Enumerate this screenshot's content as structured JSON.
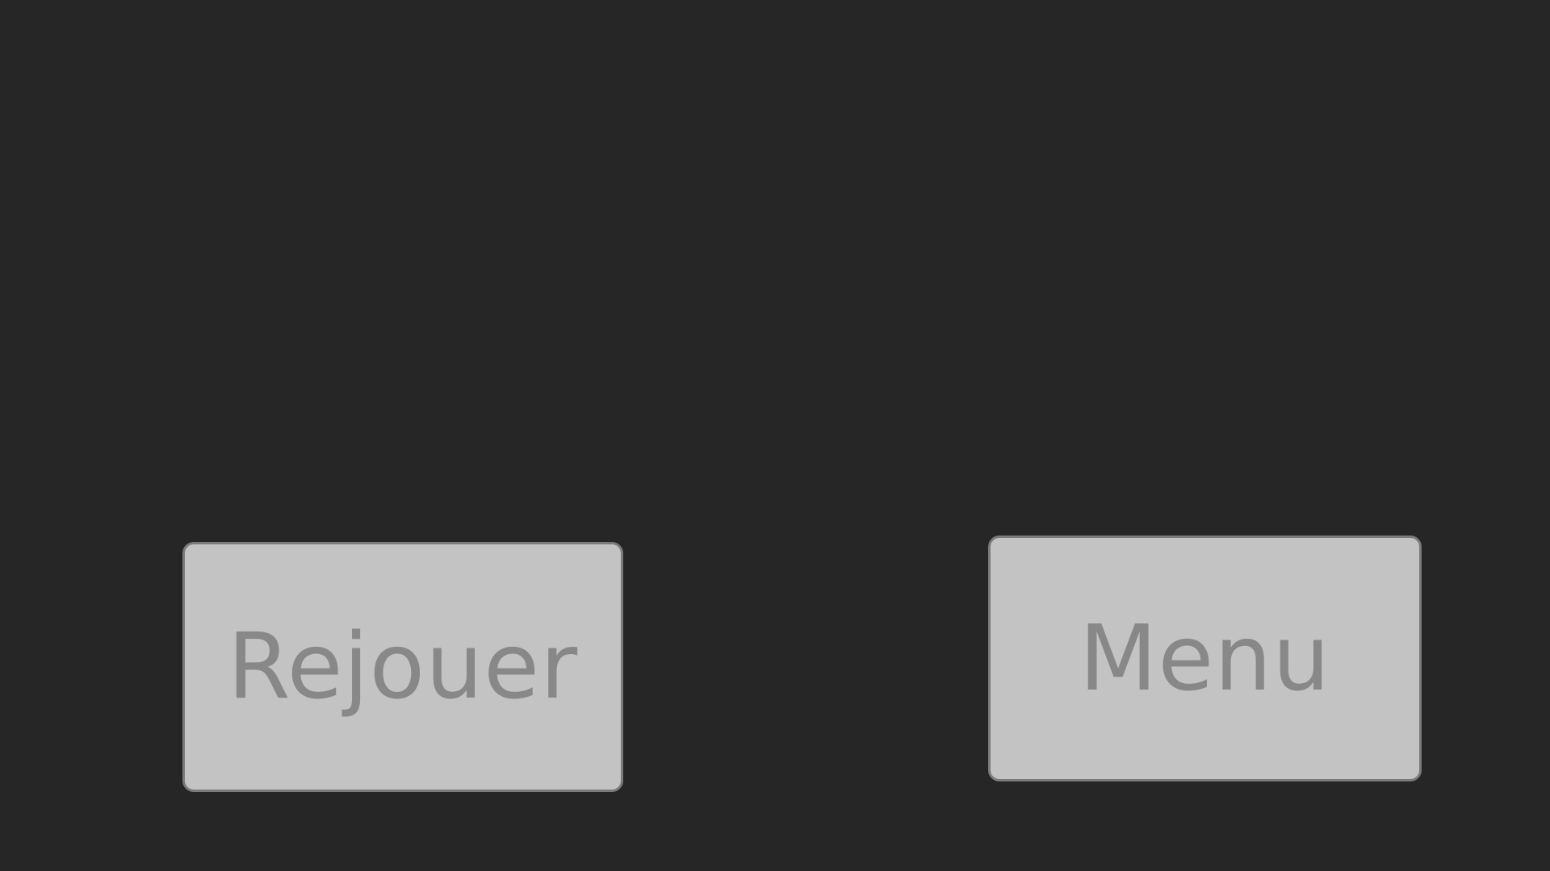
{
  "buttons": {
    "replay_label": "Rejouer",
    "menu_label": "Menu"
  },
  "colors": {
    "background": "#262626",
    "button_fill": "#c3c3c3",
    "button_border": "#7b7b7b",
    "button_text": "#888888"
  }
}
